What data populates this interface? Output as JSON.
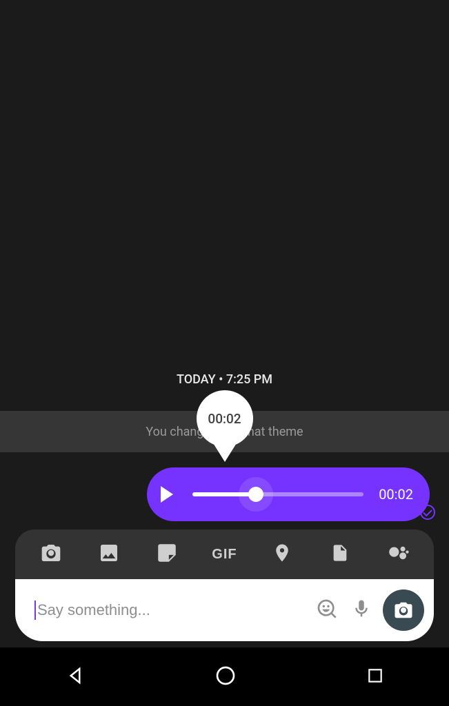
{
  "timestamp": {
    "day": "TODAY",
    "sep": "•",
    "time": "7:25 PM"
  },
  "system_message": "You changed the chat theme",
  "audio": {
    "tooltip_time": "00:02",
    "duration": "00:02",
    "progress_pct": 37
  },
  "attachments": {
    "camera": "camera-icon",
    "gallery": "gallery-icon",
    "sticker": "sticker-icon",
    "gif_label": "GIF",
    "location": "location-icon",
    "file": "file-icon",
    "assistant": "assistant-icon"
  },
  "input": {
    "placeholder": "Say something..."
  },
  "colors": {
    "accent": "#7633ff",
    "bg": "#1b1b1b"
  }
}
